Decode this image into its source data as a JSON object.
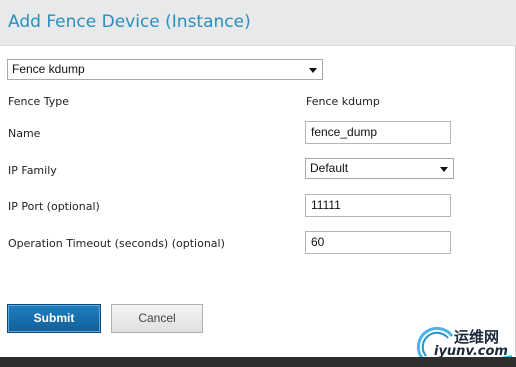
{
  "dialog": {
    "title": "Add Fence Device (Instance)"
  },
  "device_select": {
    "selected": "Fence kdump"
  },
  "fields": {
    "fence_type": {
      "label": "Fence Type",
      "value": "Fence kdump"
    },
    "name": {
      "label": "Name",
      "value": "fence_dump"
    },
    "ip_family": {
      "label": "IP Family",
      "selected": "Default"
    },
    "ip_port": {
      "label": "IP Port (optional)",
      "value": "11111"
    },
    "timeout": {
      "label": "Operation Timeout (seconds) (optional)",
      "value": "60"
    }
  },
  "buttons": {
    "submit": "Submit",
    "cancel": "Cancel"
  },
  "watermark": {
    "cn": "运维网",
    "en": "iyunv.com"
  },
  "colors": {
    "title": "#2a8fbd",
    "submit_bg": "#1a6fad"
  }
}
